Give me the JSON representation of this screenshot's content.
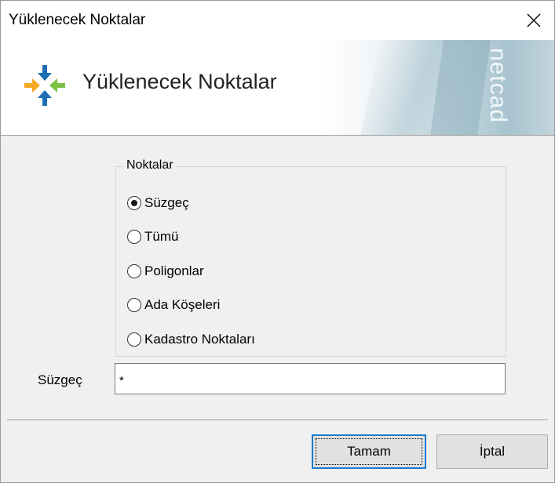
{
  "window": {
    "title": "Yüklenecek Noktalar"
  },
  "banner": {
    "title": "Yüklenecek Noktalar",
    "watermark": "netcad"
  },
  "points_group": {
    "legend": "Noktalar",
    "options": [
      {
        "label": "Süzgeç",
        "checked": true
      },
      {
        "label": "Tümü",
        "checked": false
      },
      {
        "label": "Poligonlar",
        "checked": false
      },
      {
        "label": "Ada Köşeleri",
        "checked": false
      },
      {
        "label": "Kadastro Noktaları",
        "checked": false
      }
    ]
  },
  "filter": {
    "label": "Süzgeç",
    "value": "*"
  },
  "buttons": {
    "ok": "Tamam",
    "cancel": "İptal"
  },
  "colors": {
    "accent": "#1b7bd0",
    "logo_blue": "#1c6fb7",
    "logo_green": "#7cc242",
    "logo_orange": "#f7a823"
  }
}
